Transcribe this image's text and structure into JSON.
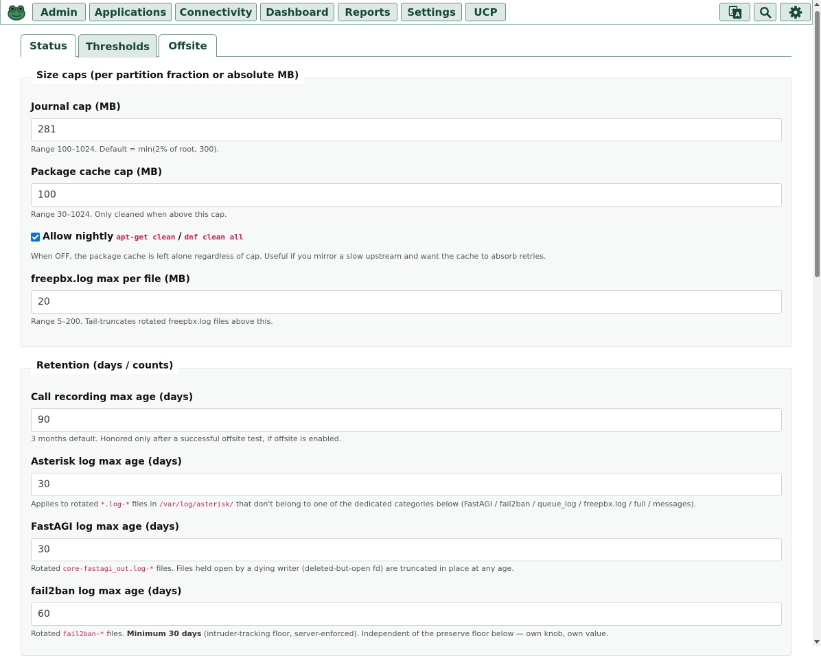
{
  "nav": {
    "items": [
      "Admin",
      "Applications",
      "Connectivity",
      "Dashboard",
      "Reports",
      "Settings",
      "UCP"
    ],
    "icons": [
      "logo-icon",
      "translate-icon",
      "search-icon",
      "gear-icon"
    ]
  },
  "tabs": [
    "Status",
    "Thresholds",
    "Offsite"
  ],
  "active_tab": "Thresholds",
  "size_caps": {
    "legend": "Size caps (per partition fraction or absolute MB)",
    "journal_label": "Journal cap (MB)",
    "journal_value": "281",
    "journal_help": "Range 100–1024. Default = min(2% of root, 300).",
    "pkg_label": "Package cache cap (MB)",
    "pkg_value": "100",
    "pkg_help": "Range 30–1024. Only cleaned when above this cap.",
    "nightly_label": "Allow nightly",
    "nightly_cmd1": "apt-get clean",
    "nightly_sep": "/",
    "nightly_cmd2": "dnf clean all",
    "nightly_checked": true,
    "nightly_help": "When OFF, the package cache is left alone regardless of cap. Useful if you mirror a slow upstream and want the cache to absorb retries.",
    "freepbx_label": "freepbx.log max per file (MB)",
    "freepbx_value": "20",
    "freepbx_help": "Range 5–200. Tail-truncates rotated freepbx.log files above this."
  },
  "retention": {
    "legend": "Retention (days / counts)",
    "callrec_label": "Call recording max age (days)",
    "callrec_value": "90",
    "callrec_help": "3 months default. Honored only after a successful offsite test, if offsite is enabled.",
    "asterisk_label": "Asterisk log max age (days)",
    "asterisk_value": "30",
    "asterisk_help_1": "Applies to rotated",
    "asterisk_code_1": "*.log-*",
    "asterisk_help_2": "files in",
    "asterisk_code_2": "/var/log/asterisk/",
    "asterisk_help_3": "that don't belong to one of the dedicated categories below (FastAGI / fail2ban / queue_log / freepbx.log / full / messages).",
    "fastagi_label": "FastAGI log max age (days)",
    "fastagi_value": "30",
    "fastagi_help_1": "Rotated",
    "fastagi_code": "core-fastagi_out.log-*",
    "fastagi_help_2": "files. Files held open by a dying writer (deleted-but-open fd) are truncated in place at any age.",
    "fail2ban_label": "fail2ban log max age (days)",
    "fail2ban_value": "60",
    "fail2ban_help_1": "Rotated",
    "fail2ban_code": "fail2ban-*",
    "fail2ban_help_2": "files.",
    "fail2ban_strong": "Minimum 30 days",
    "fail2ban_help_3": "(intruder-tracking floor, server-enforced). Independent of the preserve floor below — own knob, own value."
  }
}
